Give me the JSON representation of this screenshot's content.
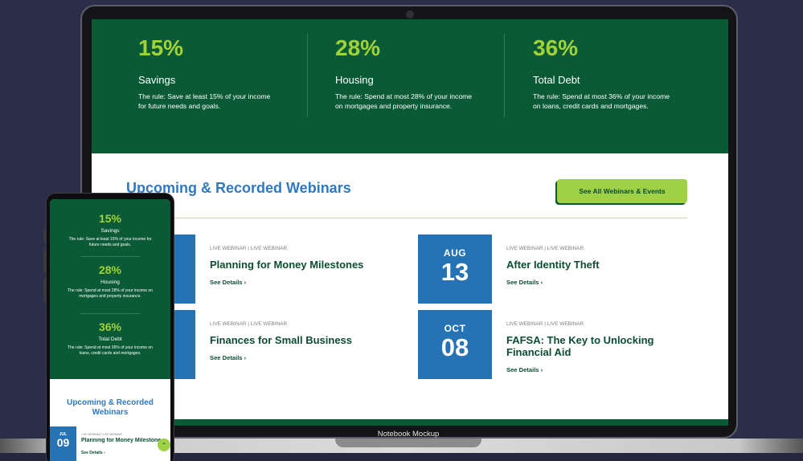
{
  "laptop": {
    "stats": [
      {
        "percent": "15%",
        "label": "Savings",
        "description": "The rule: Save at least 15% of your income for future needs and goals."
      },
      {
        "percent": "28%",
        "label": "Housing",
        "description": "The rule: Spend at most 28% of your income on mortgages and property insurance."
      },
      {
        "percent": "36%",
        "label": "Total Debt",
        "description": "The rule: Spend at most 36% of your income on loans, credit cards and mortgages."
      }
    ],
    "webinars_title": "Upcoming & Recorded Webinars",
    "see_all_label": "See All Webinars & Events",
    "cards": [
      {
        "month": "",
        "day": "",
        "meta": "LIVE WEBINAR | LIVE WEBINAR",
        "title": "Planning for Money Milestones",
        "link": "See Details ›"
      },
      {
        "month": "AUG",
        "day": "13",
        "meta": "LIVE WEBINAR | LIVE WEBINAR",
        "title": "After Identity Theft",
        "link": "See Details ›"
      },
      {
        "month": "",
        "day": "",
        "meta": "LIVE WEBINAR | LIVE WEBINAR",
        "title": "Finances for Small Business",
        "link": "See Details ›"
      },
      {
        "month": "OCT",
        "day": "08",
        "meta": "LIVE WEBINAR | LIVE WEBINAR",
        "title": "FAFSA: The Key to Unlocking Financial Aid",
        "link": "See Details ›"
      }
    ],
    "caption": "Notebook Mockup"
  },
  "phone": {
    "stats": [
      {
        "percent": "15%",
        "label": "Savings",
        "description": "The rule: Save at least 15% of your income for future needs and goals."
      },
      {
        "percent": "28%",
        "label": "Housing",
        "description": "The rule: Spend at most 28% of your income on mortgages and property insurance."
      },
      {
        "percent": "36%",
        "label": "Total Debt",
        "description": "The rule: Spend at most 36% of your income on loans, credit cards and mortgages."
      }
    ],
    "webinars_title": "Upcoming & Recorded Webinars",
    "card": {
      "month": "JUL",
      "day": "09",
      "meta": "LIVE WEBINAR | LIVE WEBINAR",
      "title": "Planning for Money Milestones",
      "link": "See Details ›"
    },
    "scroll_top_glyph": "⌃"
  },
  "colors": {
    "brand_green": "#0a5a36",
    "accent_lime": "#a2d23a",
    "date_blue": "#2573b4",
    "title_blue": "#2d79c3"
  }
}
